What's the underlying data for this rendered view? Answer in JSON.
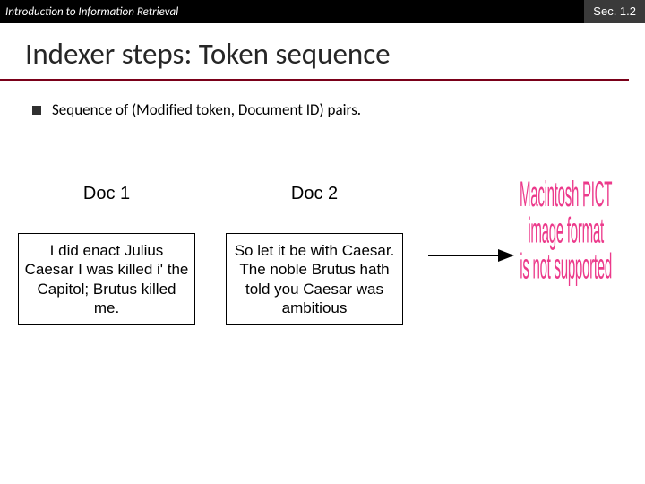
{
  "header": {
    "left": "Introduction to Information Retrieval",
    "right": "Sec. 1.2"
  },
  "title": "Indexer steps: Token sequence",
  "bullet": "Sequence of (Modified token, Document ID) pairs.",
  "docs": [
    {
      "label": "Doc 1",
      "text": "I did enact Julius Caesar I was killed i' the Capitol; Brutus killed me."
    },
    {
      "label": "Doc 2",
      "text": "So let it be with Caesar. The noble Brutus hath told you Caesar was ambitious"
    }
  ],
  "pict": {
    "l1": "Macintosh PICT",
    "l2": "image format",
    "l3": "is not supported"
  }
}
